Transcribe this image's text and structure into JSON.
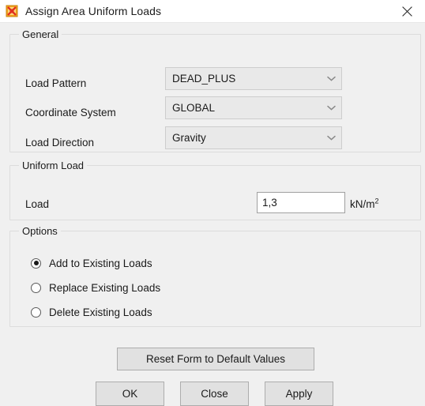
{
  "window": {
    "title": "Assign Area Uniform Loads",
    "icon": "sap-area-load-icon",
    "close_label": "✕"
  },
  "general": {
    "group_title": "General",
    "rows": [
      {
        "label": "Load Pattern",
        "value": "DEAD_PLUS",
        "name": "load-pattern"
      },
      {
        "label": "Coordinate System",
        "value": "GLOBAL",
        "name": "coordinate-system"
      },
      {
        "label": "Load Direction",
        "value": "Gravity",
        "name": "load-direction"
      }
    ]
  },
  "uniform_load": {
    "group_title": "Uniform Load",
    "label": "Load",
    "value": "1,3",
    "unit_main": "kN/m",
    "unit_sup": "2"
  },
  "options": {
    "group_title": "Options",
    "items": [
      {
        "label": "Add to Existing Loads",
        "selected": true
      },
      {
        "label": "Replace Existing Loads",
        "selected": false
      },
      {
        "label": "Delete Existing Loads",
        "selected": false
      }
    ]
  },
  "buttons": {
    "reset": "Reset Form to Default Values",
    "ok": "OK",
    "close": "Close",
    "apply": "Apply"
  },
  "colors": {
    "dialog_bg": "#f0f0f0",
    "titlebar_bg": "#ffffff",
    "combo_bg": "#e9e9e9",
    "button_bg": "#e1e1e1",
    "input_bg": "#ffffff",
    "groupbox_border": "#dcdcdc",
    "icon_orange": "#f2a21c",
    "icon_red": "#e03020"
  }
}
